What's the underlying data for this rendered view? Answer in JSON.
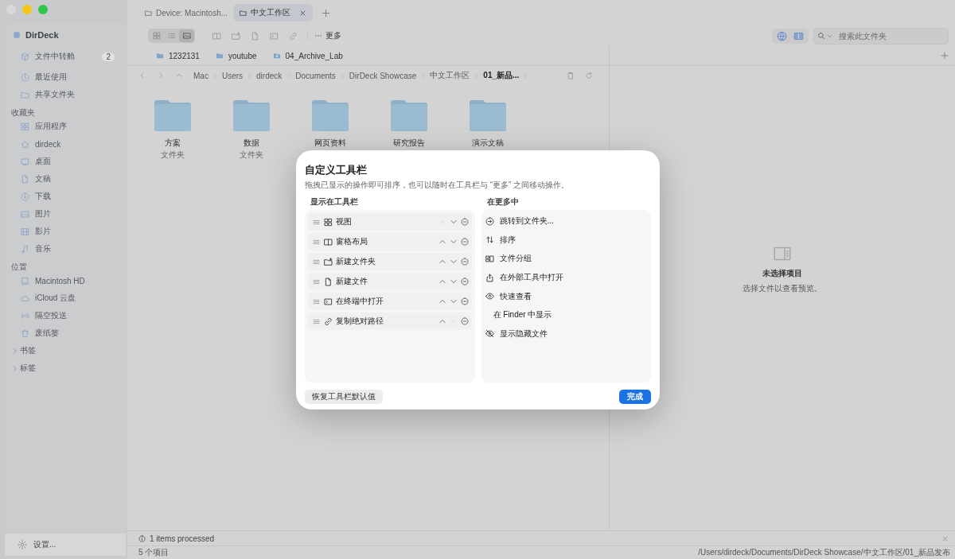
{
  "tabs": [
    {
      "label": "Device: Macintosh...",
      "selected": false
    },
    {
      "label": "中文工作区",
      "selected": true
    }
  ],
  "toolbar": {
    "view_modes": [
      {
        "selected": false
      },
      {
        "selected": false
      },
      {
        "selected": true
      }
    ],
    "more": "更多",
    "search": {
      "placeholder": "搜索此文件夹"
    }
  },
  "favorites_bar": [
    {
      "label": "1232131",
      "kind": "folder"
    },
    {
      "label": "youtube",
      "kind": "folder"
    },
    {
      "label": "04_Archive_Lab",
      "kind": "alias"
    }
  ],
  "sidebar": {
    "app_title": "DirDeck",
    "transfer": {
      "label": "文件中转舱",
      "badge": "2"
    },
    "items": [
      "最近使用",
      "共享文件夹"
    ],
    "sections": [
      {
        "title": "收藏夹",
        "items": [
          "应用程序",
          "dirdeck",
          "桌面",
          "文稿",
          "下载",
          "图片",
          "影片",
          "音乐"
        ]
      },
      {
        "title": "位置",
        "items": [
          "Macintosh HD",
          "iCloud 云盘",
          "隔空投送",
          "废纸篓"
        ]
      }
    ],
    "groups": [
      {
        "label": "书签",
        "expanded": false
      },
      {
        "label": "标签",
        "expanded": false
      }
    ],
    "settings": "设置..."
  },
  "breadcrumb": [
    "Mac",
    "Users",
    "dirdeck",
    "Documents",
    "DirDeck Showcase",
    "中文工作区",
    "01_新品..."
  ],
  "files": [
    {
      "name": "方案",
      "type": "文件夹"
    },
    {
      "name": "数据",
      "type": "文件夹"
    },
    {
      "name": "网页资料"
    },
    {
      "name": "研究报告"
    },
    {
      "name": "演示文稿"
    }
  ],
  "preview": {
    "title": "未选择项目",
    "hint": "选择文件以查看预览。"
  },
  "status": {
    "message": "1 items processed",
    "count": "5 个项目",
    "path": "/Users/dirdeck/Documents/DirDeck Showcase/中文工作区/01_新品发布"
  },
  "dialog": {
    "title": "自定义工具栏",
    "subtitle": "拖拽已显示的操作即可排序，也可以随时在工具栏与 “更多” 之间移动操作。",
    "shown_heading": "显示在工具栏",
    "more_heading": "在更多中",
    "shown": [
      {
        "label": "视图",
        "up_enabled": false,
        "down_enabled": true
      },
      {
        "label": "窗格布局",
        "up_enabled": true,
        "down_enabled": true
      },
      {
        "label": "新建文件夹",
        "up_enabled": true,
        "down_enabled": true
      },
      {
        "label": "新建文件",
        "up_enabled": true,
        "down_enabled": true
      },
      {
        "label": "在终端中打开",
        "up_enabled": true,
        "down_enabled": true
      },
      {
        "label": "复制绝对路径",
        "up_enabled": true,
        "down_enabled": false
      }
    ],
    "more": [
      "跳转到文件夹...",
      "排序",
      "文件分组",
      "在外部工具中打开",
      "快速查看",
      "在 Finder 中显示",
      "显示隐藏文件"
    ],
    "reset_button": "恢复工具栏默认值",
    "done_button": "完成"
  }
}
